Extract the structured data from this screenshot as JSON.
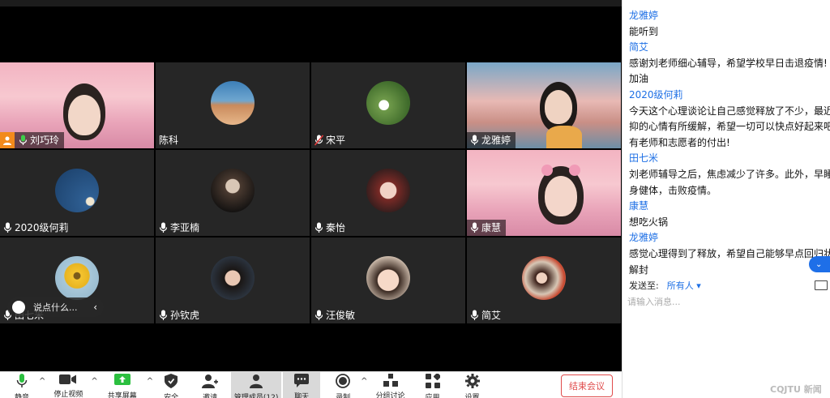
{
  "participants": [
    {
      "name": "刘巧玲",
      "mic": "on",
      "host": true,
      "video": "pink"
    },
    {
      "name": "陈科",
      "mic": "none",
      "video": "avatar"
    },
    {
      "name": "宋平",
      "mic": "muted",
      "video": "avatar"
    },
    {
      "name": "龙雅婷",
      "mic": "on",
      "video": "sea"
    },
    {
      "name": "2020级何莉",
      "mic": "on",
      "video": "avatar"
    },
    {
      "name": "李亚楠",
      "mic": "on",
      "video": "avatar"
    },
    {
      "name": "秦怡",
      "mic": "on",
      "video": "avatar"
    },
    {
      "name": "康慧",
      "mic": "on",
      "video": "pink"
    },
    {
      "name": "田七米",
      "mic": "on",
      "video": "avatar"
    },
    {
      "name": "孙钦虎",
      "mic": "on",
      "video": "avatar"
    },
    {
      "name": "汪俊敏",
      "mic": "on",
      "video": "avatar"
    },
    {
      "name": "简艾",
      "mic": "on",
      "video": "avatar"
    }
  ],
  "chat_pill": {
    "placeholder": "说点什么..."
  },
  "toolbar": {
    "mute": "静音",
    "stop_video": "停止视频",
    "share_screen": "共享屏幕",
    "security": "安全",
    "invite": "邀请",
    "manage_participants": "管理成员(12)",
    "chat": "聊天",
    "record": "录制",
    "breakout": "分组讨论",
    "apps": "应用",
    "settings": "设置",
    "end_meeting": "结束会议"
  },
  "chat": {
    "messages": [
      {
        "sender": "龙雅婷",
        "lines": [
          "能听到"
        ]
      },
      {
        "sender": "简艾",
        "lines": [
          "感谢刘老师细心辅导，希望学校早日击退疫情!",
          "加油"
        ]
      },
      {
        "sender": "2020级何莉",
        "lines": [
          "今天这个心理谈论让自己感觉释放了不少，最近",
          "抑的心情有所缓解，希望一切可以快点好起来吧",
          "有老师和志愿者的付出!"
        ]
      },
      {
        "sender": "田七米",
        "lines": [
          "刘老师辅导之后，焦虑减少了许多。此外，早睡",
          "身健体，击败疫情。"
        ]
      },
      {
        "sender": "康慧",
        "lines": [
          "想吃火锅"
        ]
      },
      {
        "sender": "龙雅婷",
        "lines": [
          "感觉心理得到了释放，希望自己能够早点回归状",
          "解封"
        ]
      }
    ],
    "send_to_label": "发送至:",
    "send_to_target": "所有人",
    "input_placeholder": "请输入消息..."
  },
  "watermark": "CQJTU 新闻",
  "colors": {
    "accent": "#1d6fe5",
    "end_meeting": "#e04b4b",
    "host_badge": "#f28a1c",
    "tile_bg": "#262626"
  }
}
